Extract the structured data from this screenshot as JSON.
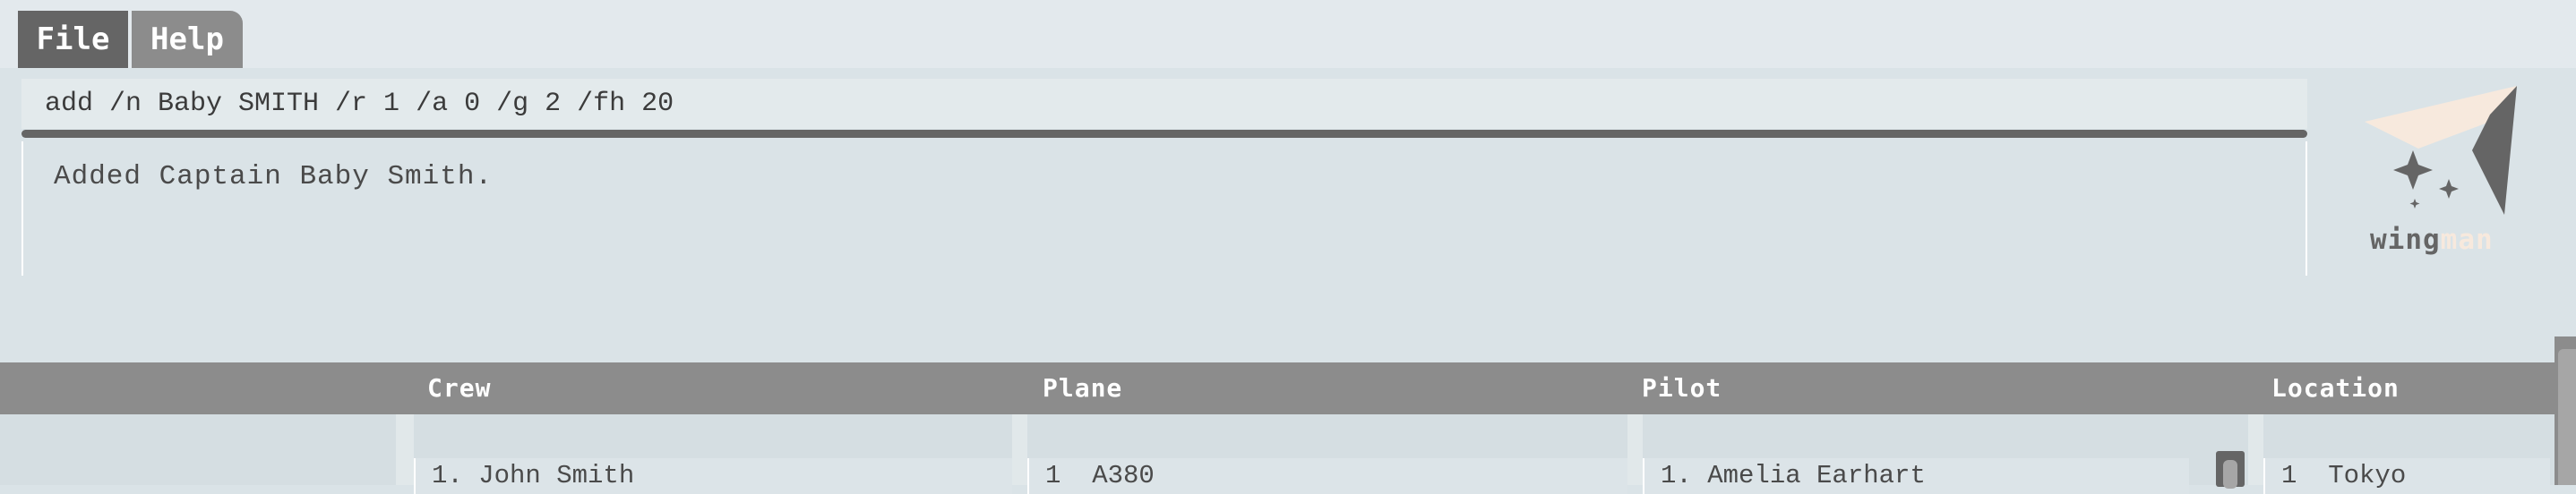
{
  "menu": {
    "file_label": "File",
    "help_label": "Help"
  },
  "command": {
    "value": "add /n Baby SMITH /r 1 /a 0 /g 2 /fh 20"
  },
  "result": {
    "text": "Added Captain Baby Smith."
  },
  "logo": {
    "text_main": "wing",
    "text_accent": "man",
    "icon": "paper-plane-sparkle-icon"
  },
  "columns": {
    "crew": {
      "header": "Crew",
      "first_item": "1. John Smith"
    },
    "plane": {
      "header": "Plane",
      "first_item": "1  A380"
    },
    "pilot": {
      "header": "Pilot",
      "first_item": "1. Amelia Earhart"
    },
    "location": {
      "header": "Location",
      "first_item": "1  Tokyo"
    }
  },
  "colors": {
    "dark_gray": "#656565",
    "mid_gray": "#8c8c8c",
    "background": "#dae3e7",
    "accent_cream": "#f7e9dd"
  }
}
